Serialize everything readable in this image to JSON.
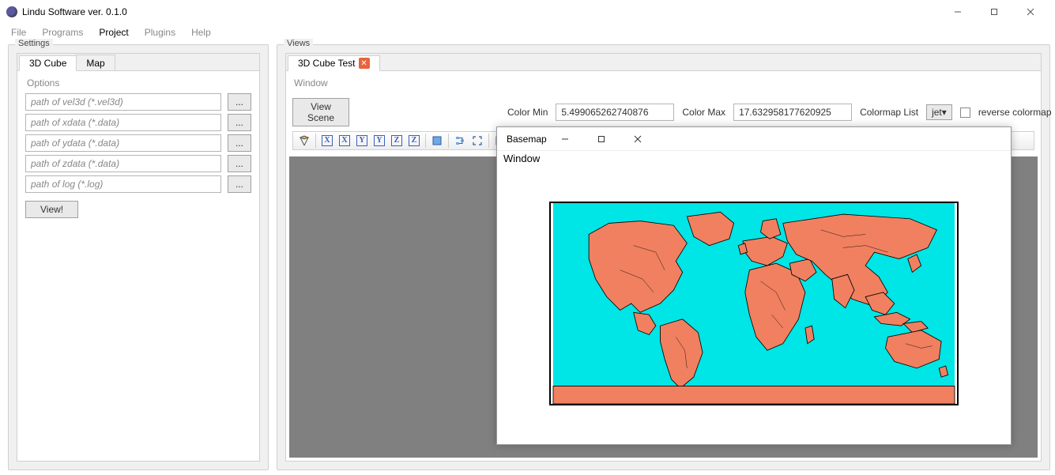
{
  "app": {
    "title": "Lindu Software ver. 0.1.0"
  },
  "menubar": {
    "file": "File",
    "programs": "Programs",
    "project": "Project",
    "plugins": "Plugins",
    "help": "Help"
  },
  "settings": {
    "title": "Settings",
    "tabs": {
      "cube": "3D Cube",
      "map": "Map"
    },
    "options_label": "Options",
    "placeholders": {
      "vel3d": "path of vel3d (*.vel3d)",
      "xdata": "path of xdata (*.data)",
      "ydata": "path of ydata (*.data)",
      "zdata": "path of zdata (*.data)",
      "log": "path of log (*.log)"
    },
    "browse": "...",
    "view_button": "View!"
  },
  "views": {
    "title": "Views",
    "tab": {
      "label": "3D Cube Test"
    },
    "window_label": "Window",
    "view_scene": "View Scene",
    "color_min_label": "Color Min",
    "color_min_value": "5.499065262740876",
    "color_max_label": "Color Max",
    "color_max_value": "17.632958177620925",
    "colormap_label": "Colormap List",
    "colormap_value": "jet",
    "reverse_label": "reverse colormap"
  },
  "popup": {
    "title": "Basemap",
    "menu": "Window"
  }
}
